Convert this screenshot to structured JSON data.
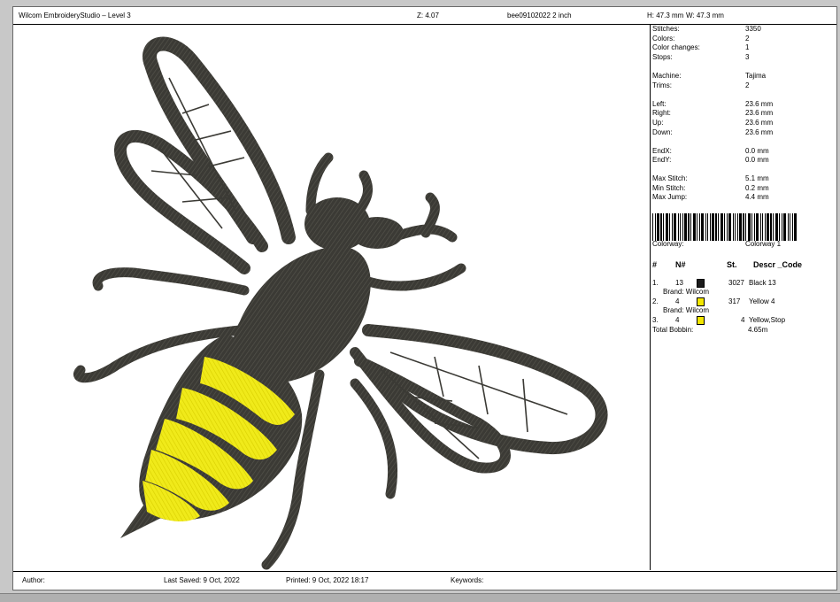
{
  "header": {
    "app_title": "Wilcom EmbroideryStudio – Level 3",
    "zoom": "Z: 4.07",
    "filename": "bee09102022 2 inch",
    "height": "H: 47.3 mm",
    "width": "W: 47.3 mm"
  },
  "stats": [
    {
      "label": "Stitches:",
      "value": "3350"
    },
    {
      "label": "Colors:",
      "value": "2"
    },
    {
      "label": "Color changes:",
      "value": "1"
    },
    {
      "label": "Stops:",
      "value": "3"
    },
    {
      "label": "Machine:",
      "value": "Tajima"
    },
    {
      "label": "Trims:",
      "value": "2"
    },
    {
      "label": "Left:",
      "value": "23.6 mm"
    },
    {
      "label": "Right:",
      "value": "23.6 mm"
    },
    {
      "label": "Up:",
      "value": "23.6 mm"
    },
    {
      "label": "Down:",
      "value": "23.6 mm"
    },
    {
      "label": "EndX:",
      "value": "0.0 mm"
    },
    {
      "label": "EndY:",
      "value": "0.0 mm"
    },
    {
      "label": "Max Stitch:",
      "value": "5.1 mm"
    },
    {
      "label": "Min Stitch:",
      "value": "0.2 mm"
    },
    {
      "label": "Max Jump:",
      "value": "4.4 mm"
    }
  ],
  "colorway": {
    "label": "Colorway:",
    "value": "Colorway 1"
  },
  "color_table": {
    "headers": {
      "num": "#",
      "needle": "N#",
      "stitches": "St.",
      "descr": "Descr _Code"
    },
    "rows": [
      {
        "num": "1.",
        "needle": "13",
        "swatch": "#1a1a1a",
        "stitches": "3027",
        "descr": "Black 13",
        "brand": "Brand: Wilcom"
      },
      {
        "num": "2.",
        "needle": "4",
        "swatch": "#f2e600",
        "stitches": "317",
        "descr": "Yellow 4",
        "brand": "Brand: Wilcom"
      },
      {
        "num": "3.",
        "needle": "4",
        "swatch": "#f2e600",
        "stitches": "4",
        "descr": "Yellow,Stop",
        "brand": ""
      }
    ],
    "total_bobbin": {
      "label": "Total Bobbin:",
      "value": "4.65m"
    }
  },
  "footer": {
    "author": "Author:",
    "last_saved": "Last Saved:  9 Oct, 2022",
    "printed": "Printed:  9 Oct, 2022 18:17",
    "keywords": "Keywords:"
  },
  "colors": {
    "thread_black": "#3b3a35",
    "thread_yellow": "#f0ea1a"
  }
}
